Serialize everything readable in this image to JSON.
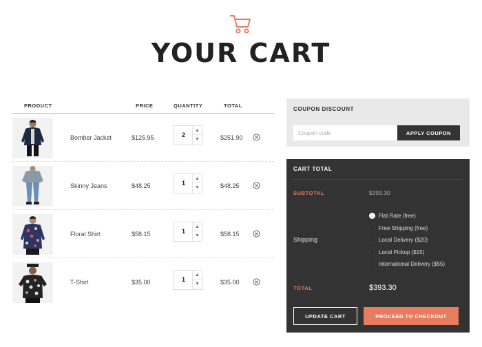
{
  "header": {
    "title": "YOUR CART",
    "icon": "shopping-cart-icon"
  },
  "colors": {
    "accent": "#e87c5f",
    "dark_panel": "#333333",
    "light_panel": "#e9e9e9"
  },
  "table": {
    "columns": {
      "product": "PRODUCT",
      "price": "PRICE",
      "quantity": "QUANTITY",
      "total": "TOTAL"
    },
    "rows": [
      {
        "name": "Bomber Jacket",
        "price": "$125.95",
        "quantity": "2",
        "total": "$251.90",
        "image_icon": "bomber-jacket-product-image"
      },
      {
        "name": "Skinny Jeans",
        "price": "$48.25",
        "quantity": "1",
        "total": "$48.25",
        "image_icon": "skinny-jeans-product-image"
      },
      {
        "name": "Floral Shirt",
        "price": "$58.15",
        "quantity": "1",
        "total": "$58.15",
        "image_icon": "floral-shirt-product-image"
      },
      {
        "name": "T-Shirt",
        "price": "$35.00",
        "quantity": "1",
        "total": "$35.00",
        "image_icon": "t-shirt-product-image"
      }
    ]
  },
  "coupon": {
    "title": "COUPON DISCOUNT",
    "placeholder": "Coupon code",
    "button": "APPLY COUPON"
  },
  "totals": {
    "title": "CART TOTAL",
    "subtotal_label": "SUBTOTAL",
    "subtotal_value": "$393.30",
    "shipping_label": "Shipping",
    "shipping_options": [
      {
        "label": "Flat Rate (free)",
        "selected": true
      },
      {
        "label": "Free Shipping (free)",
        "selected": false
      },
      {
        "label": "Local Delivery ($20)",
        "selected": false
      },
      {
        "label": "Local Pickup ($15)",
        "selected": false
      },
      {
        "label": "International Delivery ($55)",
        "selected": false
      }
    ],
    "total_label": "TOTAL",
    "total_value": "$393.30",
    "update_button": "UPDATE CART",
    "checkout_button": "PROCEED TO CHECKOUT"
  }
}
